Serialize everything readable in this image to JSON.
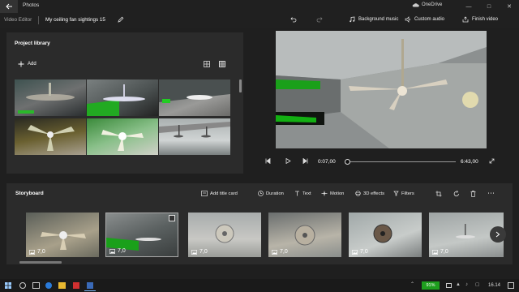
{
  "titlebar": {
    "app_title": "Photos",
    "onedrive_label": "OneDrive",
    "controls": [
      "minimize-icon",
      "maximize-icon",
      "close-icon"
    ]
  },
  "toolbar": {
    "breadcrumb_root": "Video Editor",
    "project_name": "My ceiling fan sightings 15",
    "background_music": "Background music",
    "custom_audio": "Custom audio",
    "finish_video": "Finish video"
  },
  "library": {
    "title": "Project library",
    "add_label": "Add"
  },
  "player": {
    "current_time": "0:07,00",
    "end_time": "6:43,00",
    "progress_fraction": 0.0175
  },
  "storyboard": {
    "title": "Storyboard",
    "add_title_card": "Add title card",
    "duration": "Duration",
    "text": "Text",
    "motion": "Motion",
    "effects_3d": "3D effects",
    "filters": "Filters",
    "clips": [
      {
        "duration": "7,0"
      },
      {
        "duration": "7,0"
      },
      {
        "duration": "7,0"
      },
      {
        "duration": "7,0"
      },
      {
        "duration": "7,0"
      },
      {
        "duration": "7,0"
      }
    ]
  },
  "taskbar": {
    "battery": "91%",
    "time": "16.14"
  },
  "colors": {
    "accent_green": "#00c000",
    "panel": "#2b2b2b",
    "background": "#1f1f1f"
  }
}
